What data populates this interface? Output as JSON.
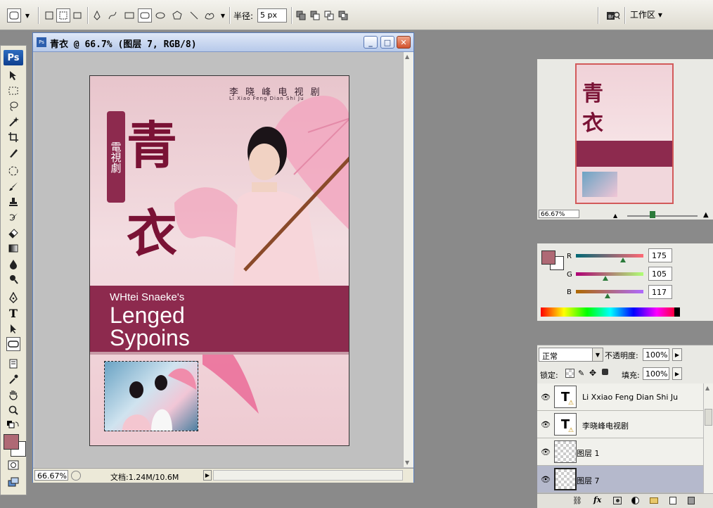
{
  "options_bar": {
    "radius_label": "半径:",
    "radius_value": "5 px",
    "workspace_label": "工作区 ▾"
  },
  "document": {
    "title": "青衣 @ 66.7% (图层 7, RGB/8)",
    "zoom": "66.67%",
    "doc_info": "文档:1.24M/10.6M"
  },
  "poster": {
    "credit_cn": "李 晓 峰 电 视 剧",
    "credit_en": "Li Xiao Feng Dian Shi Ju",
    "scroll_text": "電視劇",
    "title_char_1": "青",
    "title_char_2": "衣",
    "band_small": "WHtei Snaeke's",
    "band_line1": "Lenged",
    "band_line2": "Sypoins"
  },
  "navigator": {
    "zoom": "66.67%"
  },
  "color": {
    "r_label": "R",
    "r_value": "175",
    "g_label": "G",
    "g_value": "105",
    "b_label": "B",
    "b_value": "117",
    "foreground": "#af6975"
  },
  "layers": {
    "blend_mode": "正常",
    "opacity_label": "不透明度:",
    "opacity_value": "100%",
    "lock_label": "锁定:",
    "fill_label": "填充:",
    "fill_value": "100%",
    "rows": [
      {
        "name": "Li Xxiao Feng Dian Shi Ju",
        "type": "text"
      },
      {
        "name": "李晓峰电视剧",
        "type": "text"
      },
      {
        "name": "图层 1",
        "type": "pixel"
      },
      {
        "name": "图层 7",
        "type": "pixel"
      }
    ]
  }
}
